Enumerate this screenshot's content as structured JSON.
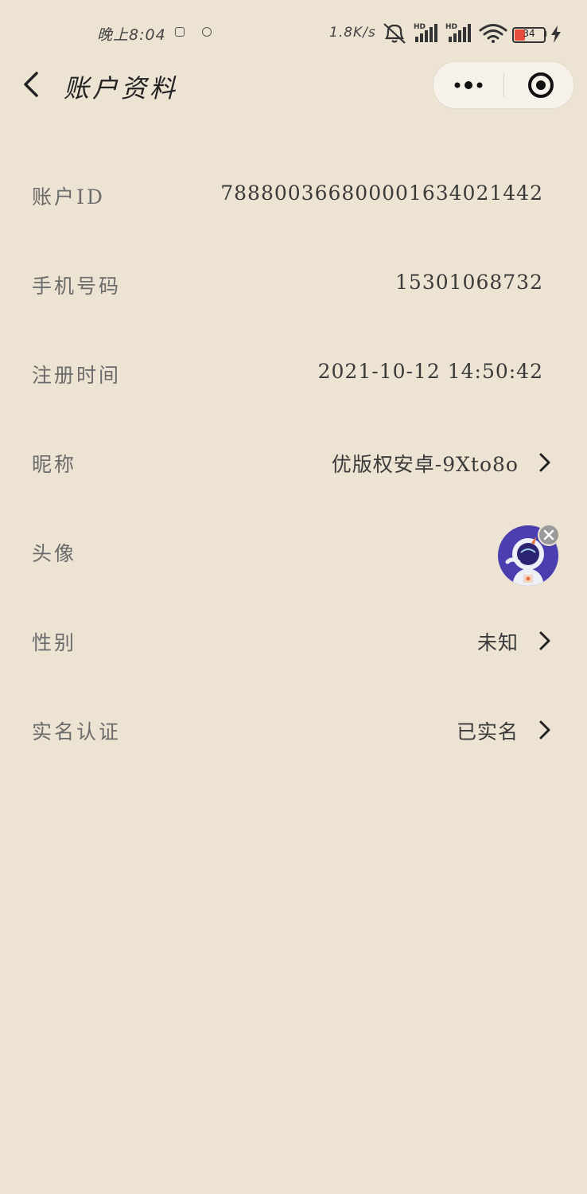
{
  "status_bar": {
    "time": "晚上8:04",
    "network_speed": "1.8K/s",
    "battery_level": "34",
    "battery_fraction": 0.34,
    "icons": [
      "alarm-icon",
      "mute-icon",
      "signal-hd-icon",
      "signal-hd-icon",
      "wifi-icon",
      "battery-icon",
      "charging-icon"
    ]
  },
  "nav": {
    "title": "账户资料"
  },
  "rows": [
    {
      "label": "账户ID",
      "value": "788800366800001634021442"
    },
    {
      "label": "手机号码",
      "value": "15301068732"
    },
    {
      "label": "注册时间",
      "value": "2021-10-12 14:50:42"
    },
    {
      "label": "昵称",
      "value": "优版权安卓-9Xto8o"
    },
    {
      "label": "头像",
      "value": ""
    },
    {
      "label": "性别",
      "value": "未知"
    },
    {
      "label": "实名认证",
      "value": "已实名"
    }
  ],
  "colors": {
    "background": "#ece3d3",
    "avatar_bg": "#4b3fb0",
    "battery_low": "#e74c3c"
  }
}
